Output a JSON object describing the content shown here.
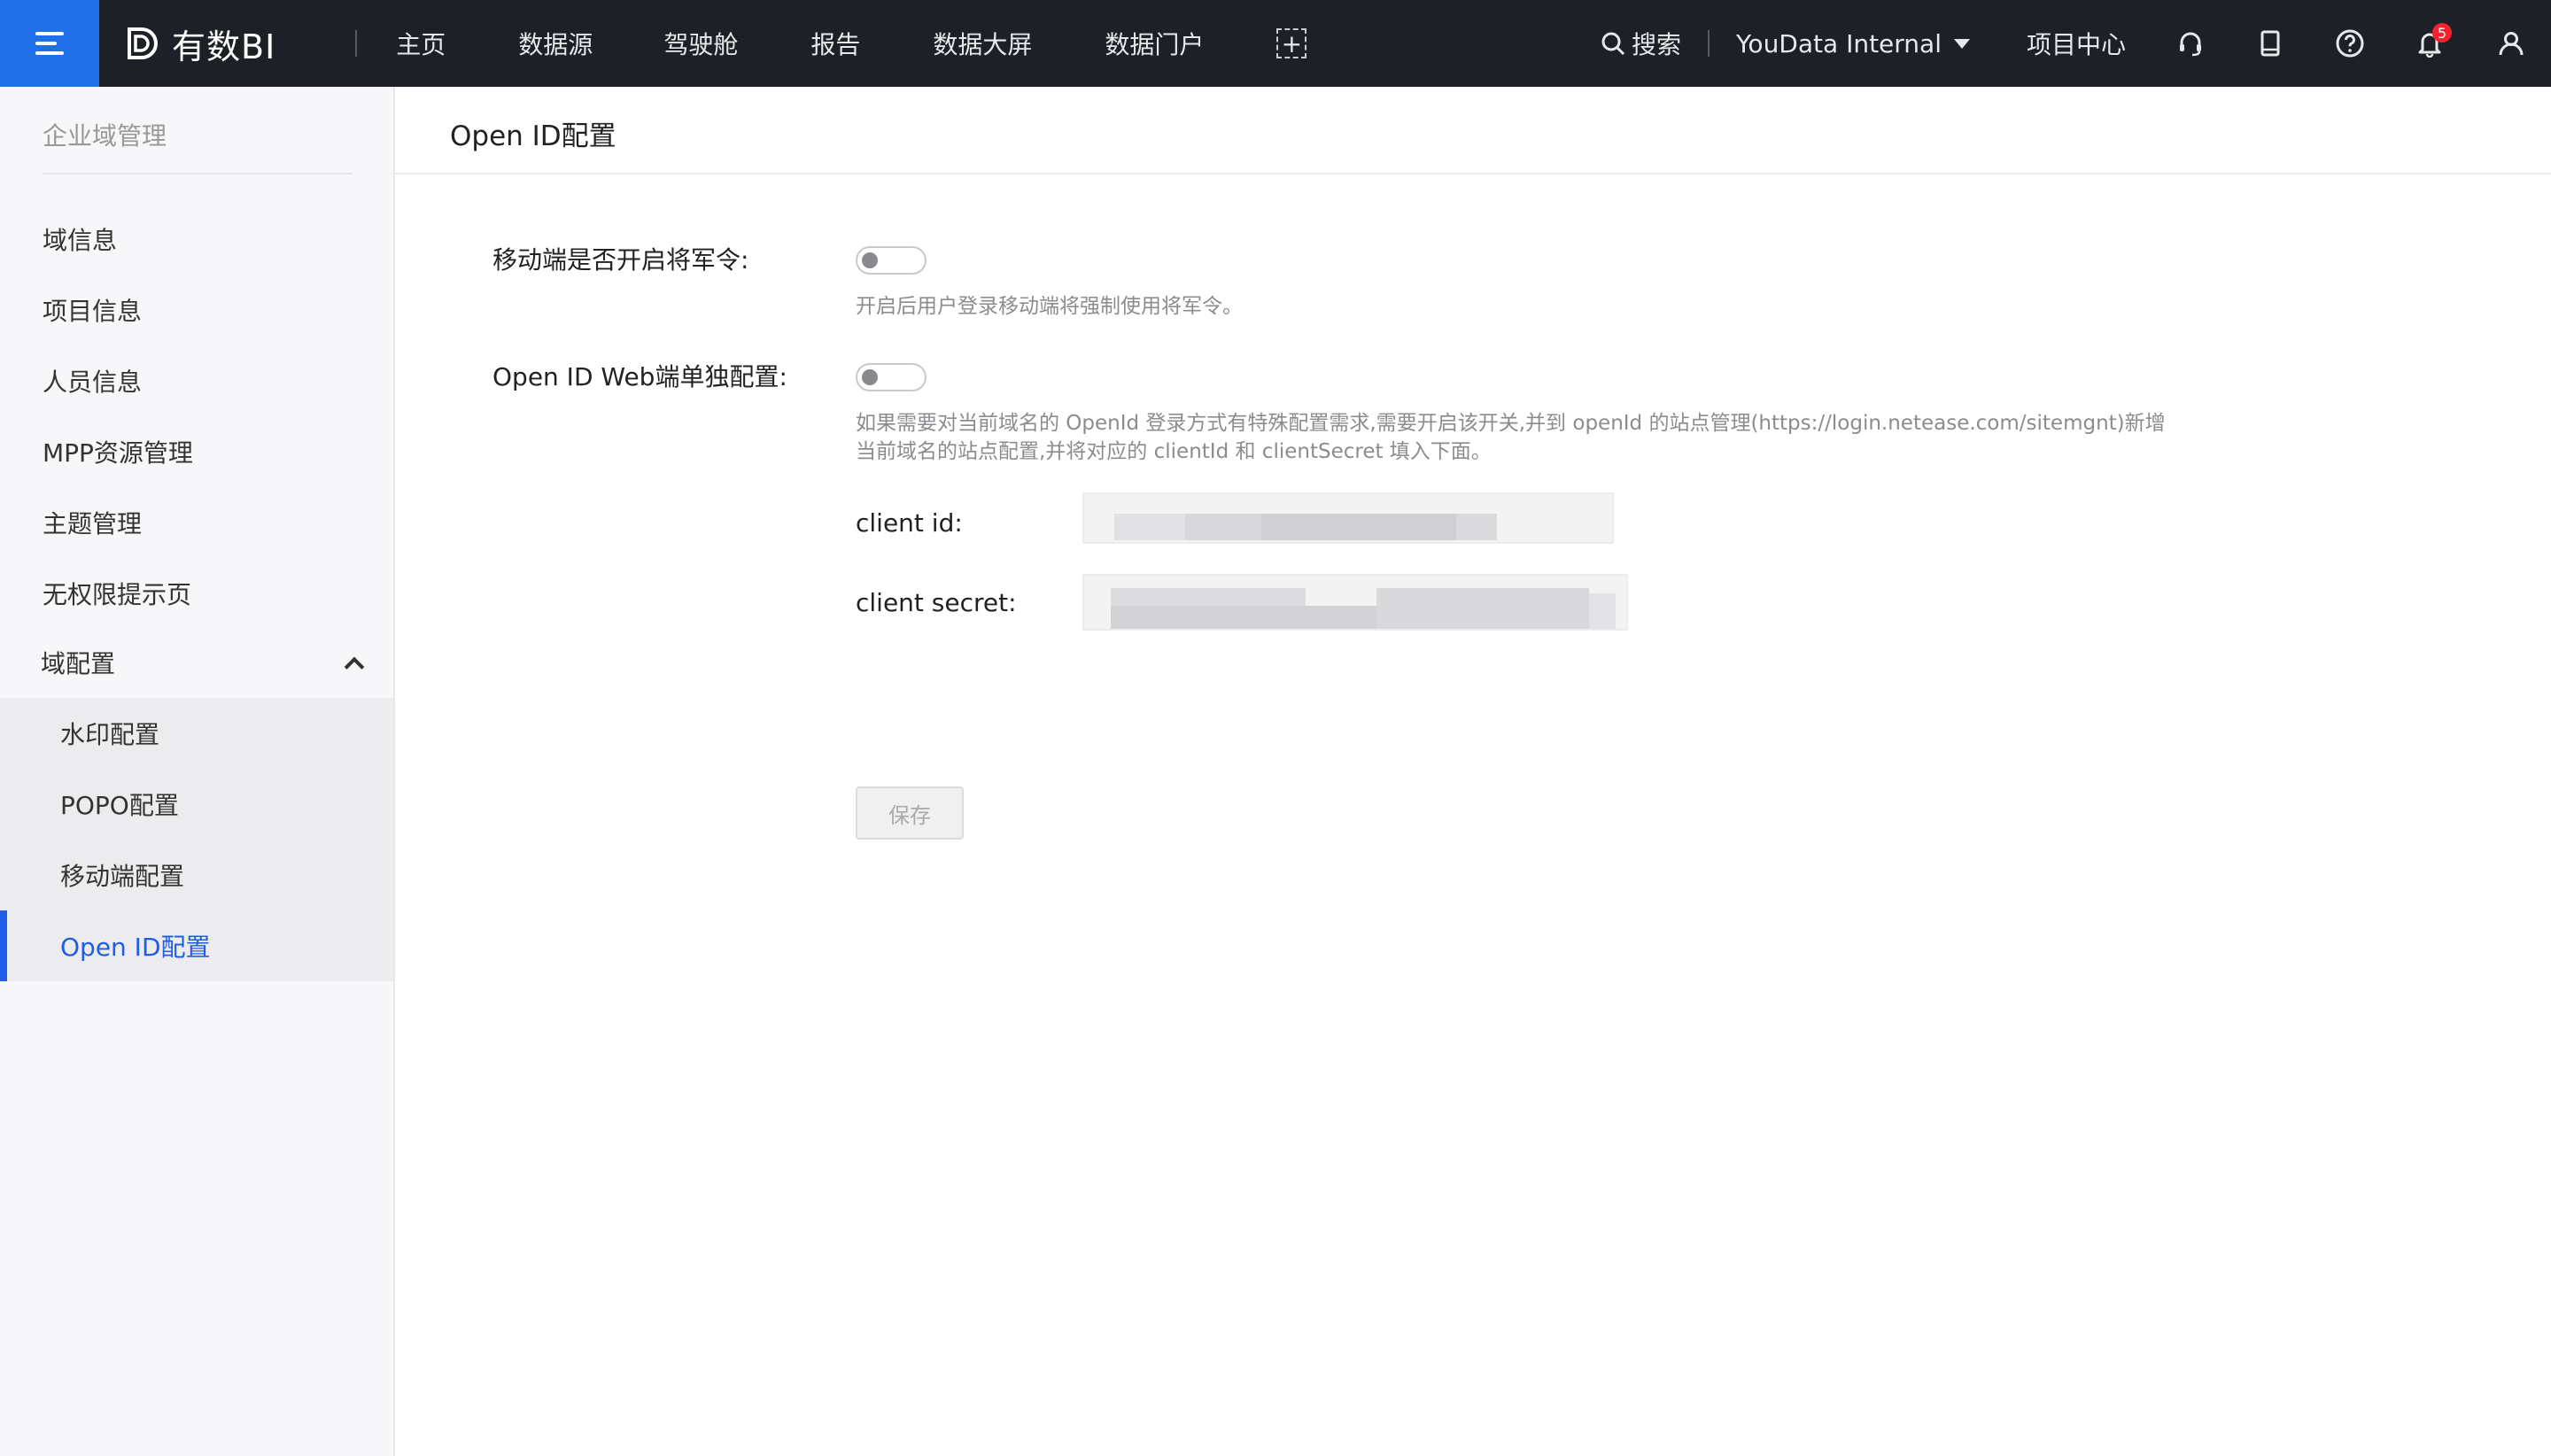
{
  "topbar": {
    "brand": "有数BI",
    "nav": [
      "主页",
      "数据源",
      "驾驶舱",
      "报告",
      "数据大屏",
      "数据门户"
    ],
    "add_icon": "+",
    "search_label": "搜索",
    "org_label": "YouData Internal",
    "project_center": "项目中心",
    "notification_count": "5",
    "icons": [
      "headset-icon",
      "book-icon",
      "help-icon",
      "bell-icon",
      "user-icon"
    ],
    "accent_color": "#1f6fe8"
  },
  "sidebar": {
    "title": "企业域管理",
    "items": [
      "域信息",
      "项目信息",
      "人员信息",
      "MPP资源管理",
      "主题管理",
      "无权限提示页"
    ],
    "group_label": "域配置",
    "sub_items": [
      "水印配置",
      "POPO配置",
      "移动端配置",
      "Open ID配置"
    ],
    "active_sub": "Open ID配置",
    "active_color": "#1f5de8"
  },
  "main": {
    "title": "Open ID配置",
    "mobile_toggle": {
      "label": "移动端是否开启将军令:",
      "enabled": false,
      "hint": "开启后用户登录移动端将强制使用将军令。"
    },
    "web_toggle": {
      "label": "Open ID Web端单独配置:",
      "enabled": false,
      "hint_line1": "如果需要对当前域名的 OpenId 登录方式有特殊配置需求,需要开启该开关,并到 openId 的站点管理(https://login.netease.com/sitemgnt)新增",
      "hint_line2": "当前域名的站点配置,并将对应的 clientId 和 clientSecret 填入下面。"
    },
    "client_id_label": "client id:",
    "client_secret_label": "client secret:",
    "save_label": "保存"
  }
}
